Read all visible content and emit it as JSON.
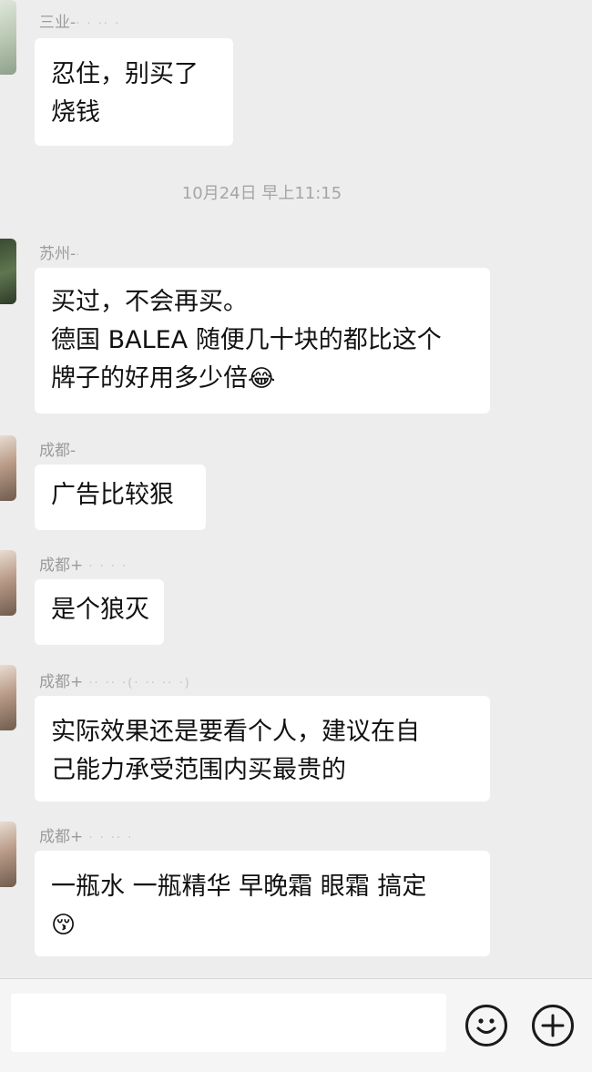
{
  "messages": [
    {
      "sender": "三业-",
      "lines": [
        "忍住，别买了",
        "烧钱"
      ]
    },
    {
      "sender": "苏州-",
      "lines": [
        "买过，不会再买。",
        "德国 BALEA 随便几十块的都比这个",
        "牌子的好用多少倍"
      ],
      "emoji": "😂"
    },
    {
      "sender": "成都-",
      "lines": [
        "广告比较狠"
      ]
    },
    {
      "sender": "成都+",
      "lines": [
        "是个狼灭"
      ]
    },
    {
      "sender": "成都+",
      "lines": [
        "实际效果还是要看个人，建议在自",
        "己能力承受范围内买最贵的"
      ]
    },
    {
      "sender": "成都+",
      "lines": [
        "一瓶水 一瓶精华 早晚霜 眼霜 搞定"
      ],
      "emoji": "😚"
    }
  ],
  "timestamp": "10月24日 早上11:15",
  "input_bar": {
    "placeholder": "",
    "emoji_button_icon": "smiley-face-icon",
    "more_button_icon": "plus-circle-icon"
  },
  "colors": {
    "background": "#ededed",
    "bubble": "#ffffff",
    "sender_text": "#9b9b9b",
    "timestamp_text": "#a5a5a5"
  }
}
